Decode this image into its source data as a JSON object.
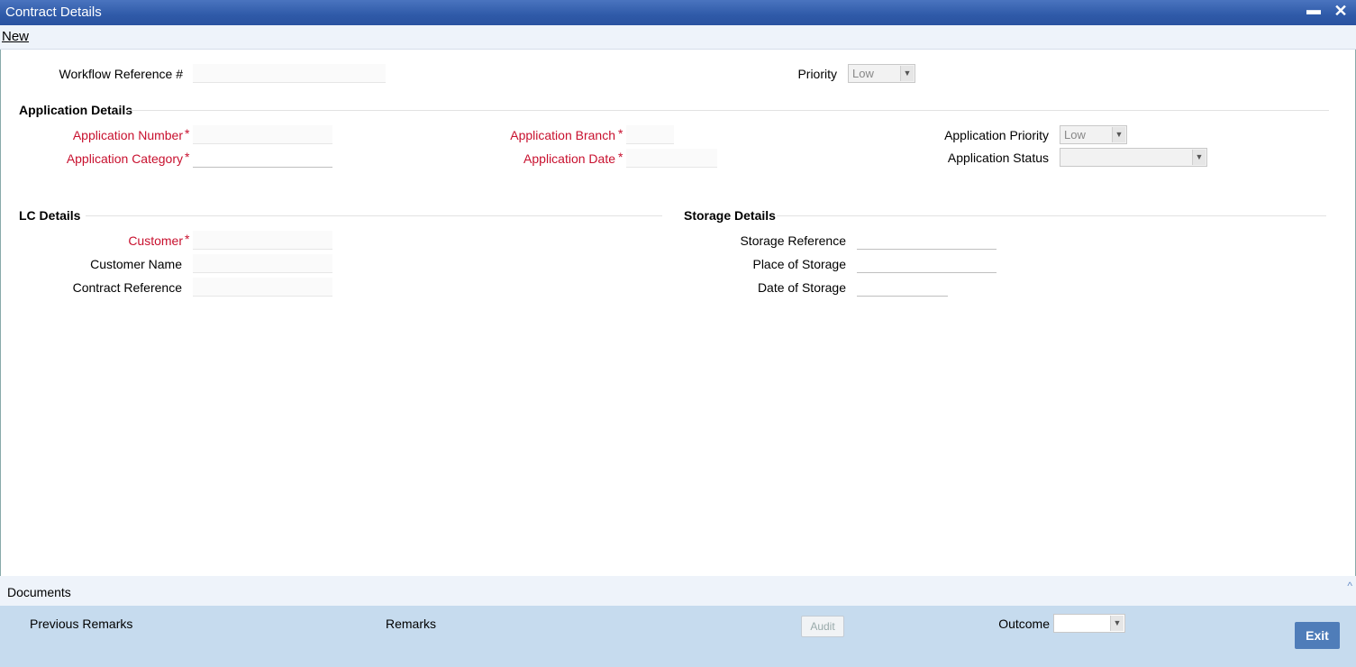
{
  "window": {
    "title": "Contract Details"
  },
  "toolbar": {
    "new_label": "New"
  },
  "header": {
    "workflow_ref_label": "Workflow Reference #",
    "workflow_ref_value": "",
    "priority_label": "Priority",
    "priority_value": "Low"
  },
  "application": {
    "section_title": "Application Details",
    "number_label": "Application Number",
    "category_label": "Application Category",
    "branch_label": "Application Branch",
    "date_label": "Application Date",
    "priority_label": "Application Priority",
    "priority_value": "Low",
    "status_label": "Application Status",
    "status_value": "",
    "required_mark": "*"
  },
  "lc": {
    "section_title": "LC Details",
    "customer_label": "Customer",
    "customer_name_label": "Customer Name",
    "contract_ref_label": "Contract Reference"
  },
  "storage": {
    "section_title": "Storage Details",
    "reference_label": "Storage Reference",
    "place_label": "Place of Storage",
    "date_label": "Date of Storage"
  },
  "footer": {
    "documents_label": "Documents",
    "collapse_icon": "^",
    "previous_remarks_label": "Previous Remarks",
    "remarks_label": "Remarks",
    "audit_label": "Audit",
    "outcome_label": "Outcome",
    "outcome_value": "",
    "exit_label": "Exit"
  },
  "icons": {
    "minimize": "▬",
    "close": "✕",
    "dropdown": "▼"
  },
  "colors": {
    "title_bar": "#2f5aa8",
    "required": "#c8102e",
    "footer": "#c6dbee",
    "exit_button": "#4f7db9"
  }
}
